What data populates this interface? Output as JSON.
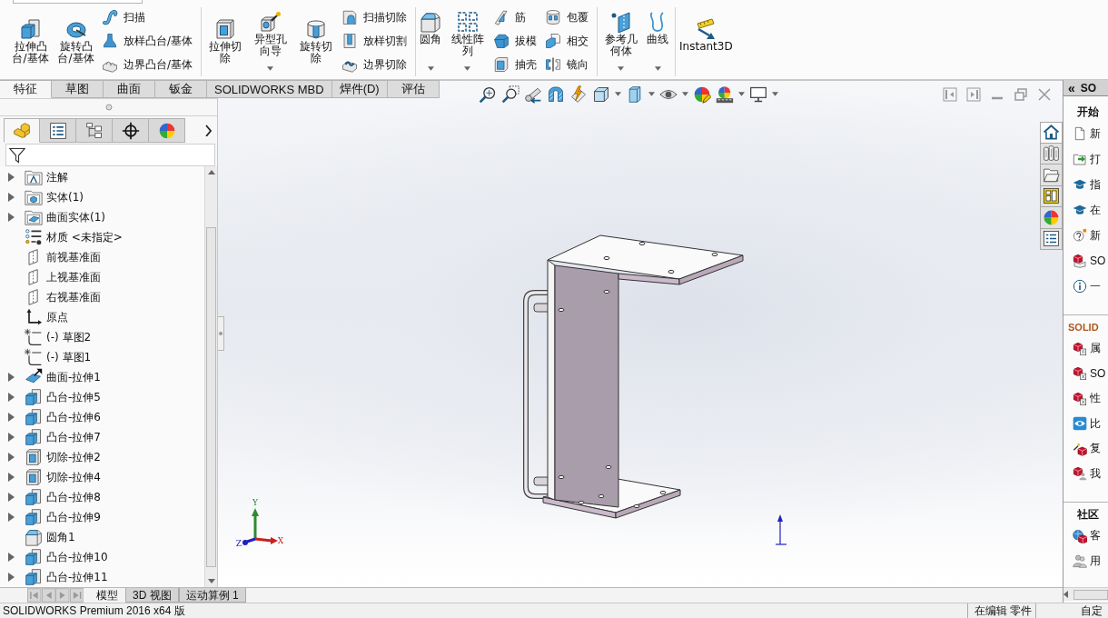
{
  "ribbon": {
    "groups": [
      {
        "columns": [
          {
            "kind": "large",
            "label": "拉伸凸台/基体",
            "dropdown": false
          },
          {
            "kind": "large",
            "label": "旋转凸台/基体",
            "dropdown": false
          },
          {
            "kind": "stack",
            "buttons": [
              {
                "label": "扫描"
              },
              {
                "label": "放样凸台/基体"
              },
              {
                "label": "边界凸台/基体"
              }
            ]
          }
        ]
      },
      {
        "columns": [
          {
            "kind": "large",
            "label": "拉伸切除",
            "dropdown": false
          },
          {
            "kind": "large",
            "label": "异型孔向导",
            "dropdown": true
          },
          {
            "kind": "large",
            "label": "旋转切除",
            "dropdown": false
          },
          {
            "kind": "stack",
            "buttons": [
              {
                "label": "扫描切除"
              },
              {
                "label": "放样切割"
              },
              {
                "label": "边界切除"
              }
            ]
          }
        ]
      },
      {
        "columns": [
          {
            "kind": "large",
            "label": "圆角",
            "dropdown": true
          },
          {
            "kind": "large",
            "label": "线性阵列",
            "dropdown": true
          },
          {
            "kind": "stack",
            "buttons": [
              {
                "label": "筋"
              },
              {
                "label": "拔模"
              },
              {
                "label": "抽壳"
              }
            ]
          },
          {
            "kind": "stack",
            "buttons": [
              {
                "label": "包覆"
              },
              {
                "label": "相交"
              },
              {
                "label": "镜向"
              }
            ]
          }
        ]
      },
      {
        "columns": [
          {
            "kind": "large",
            "label": "参考几何体",
            "dropdown": true
          },
          {
            "kind": "large",
            "label": "曲线",
            "dropdown": true
          }
        ]
      },
      {
        "columns": [
          {
            "kind": "large",
            "label": "Instant3D",
            "dropdown": false
          }
        ]
      }
    ]
  },
  "command_tabs": [
    {
      "label": "特征",
      "selected": true
    },
    {
      "label": "草图",
      "selected": false
    },
    {
      "label": "曲面",
      "selected": false
    },
    {
      "label": "钣金",
      "selected": false
    },
    {
      "label": "SOLIDWORKS MBD",
      "selected": false
    },
    {
      "label": "焊件(D)",
      "selected": false
    },
    {
      "label": "评估",
      "selected": false
    }
  ],
  "manager_tabs": [
    {
      "selected": true
    },
    {
      "selected": false
    },
    {
      "selected": false
    },
    {
      "selected": false
    },
    {
      "selected": false
    }
  ],
  "feature_tree": {
    "items": [
      {
        "label": "注解",
        "kind": "annotation",
        "expandable": true
      },
      {
        "label": "实体(1)",
        "kind": "solidfolder",
        "expandable": true
      },
      {
        "label": "曲面实体(1)",
        "kind": "surfacefolder",
        "expandable": true
      },
      {
        "label": "材质 <未指定>",
        "kind": "material",
        "expandable": false
      },
      {
        "label": "前视基准面",
        "kind": "plane",
        "expandable": false
      },
      {
        "label": "上视基准面",
        "kind": "plane",
        "expandable": false
      },
      {
        "label": "右视基准面",
        "kind": "plane",
        "expandable": false
      },
      {
        "label": "原点",
        "kind": "origin",
        "expandable": false
      },
      {
        "label": "(-) 草图2",
        "kind": "sketch",
        "expandable": false
      },
      {
        "label": "(-) 草图1",
        "kind": "sketch",
        "expandable": false
      },
      {
        "label": "曲面-拉伸1",
        "kind": "surface",
        "expandable": true
      },
      {
        "label": "凸台-拉伸5",
        "kind": "boss",
        "expandable": true
      },
      {
        "label": "凸台-拉伸6",
        "kind": "boss",
        "expandable": true
      },
      {
        "label": "凸台-拉伸7",
        "kind": "boss",
        "expandable": true
      },
      {
        "label": "切除-拉伸2",
        "kind": "cut",
        "expandable": true
      },
      {
        "label": "切除-拉伸4",
        "kind": "cut",
        "expandable": true
      },
      {
        "label": "凸台-拉伸8",
        "kind": "boss",
        "expandable": true
      },
      {
        "label": "凸台-拉伸9",
        "kind": "boss",
        "expandable": true
      },
      {
        "label": "圆角1",
        "kind": "fillet",
        "expandable": false
      },
      {
        "label": "凸台-拉伸10",
        "kind": "boss",
        "expandable": true
      },
      {
        "label": "凸台-拉伸11",
        "kind": "boss",
        "expandable": true
      }
    ]
  },
  "viewport": {
    "triad_labels": [
      "Y",
      "X",
      "Z"
    ]
  },
  "view_tabs": [
    {
      "label": "模型",
      "selected": true
    },
    {
      "label": "3D 视图",
      "selected": false
    },
    {
      "label": "运动算例 1",
      "selected": false
    }
  ],
  "task_pane": {
    "collapse": "«",
    "title": "SO",
    "tabs": [
      {
        "selected": true
      },
      {
        "selected": false
      },
      {
        "selected": false
      },
      {
        "selected": false
      },
      {
        "selected": false
      },
      {
        "selected": false
      }
    ],
    "sections": [
      {
        "title": "开始",
        "kind": "plain",
        "items": [
          "新",
          "打",
          "指",
          "在",
          "新",
          "SO",
          "一"
        ]
      },
      {
        "title": "SOLID",
        "kind": "accent",
        "items": [
          "属",
          "SO",
          "性",
          "比",
          "复",
          "我"
        ]
      },
      {
        "title": "社区",
        "kind": "plain",
        "items": [
          "客",
          "用"
        ]
      }
    ]
  },
  "status_bar": {
    "product": "SOLIDWORKS Premium 2016 x64 版",
    "mode": "在编辑 零件",
    "customize": "自定"
  }
}
